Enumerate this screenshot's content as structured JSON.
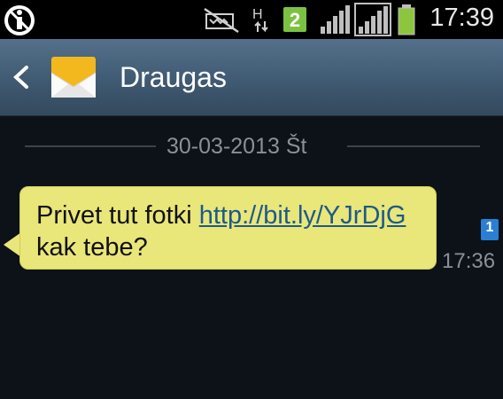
{
  "status_bar": {
    "time": "17:39",
    "network_type": "H",
    "sim_number": "2",
    "icons": [
      "accessibility-icon",
      "muted-icon",
      "data-arrows-icon",
      "sim-badge-icon",
      "signal-icon",
      "signal-icon-2",
      "battery-icon"
    ]
  },
  "header": {
    "title": "Draugas",
    "icons": [
      "back-icon",
      "envelope-icon"
    ]
  },
  "conversation": {
    "date": "30-03-2013 Št",
    "messages": [
      {
        "text_before": "Privet tut fotki ",
        "link": "http://bit.ly/YJrDjG",
        "text_after": " kak tebe?",
        "sim": "1",
        "time": "17:36"
      }
    ]
  },
  "colors": {
    "background": "#0d1218",
    "header": "#46627b",
    "bubble": "#e9e67a",
    "link": "#1c5a8a",
    "sim_badge": "#2a7fd4",
    "battery": "#8cc63f"
  }
}
